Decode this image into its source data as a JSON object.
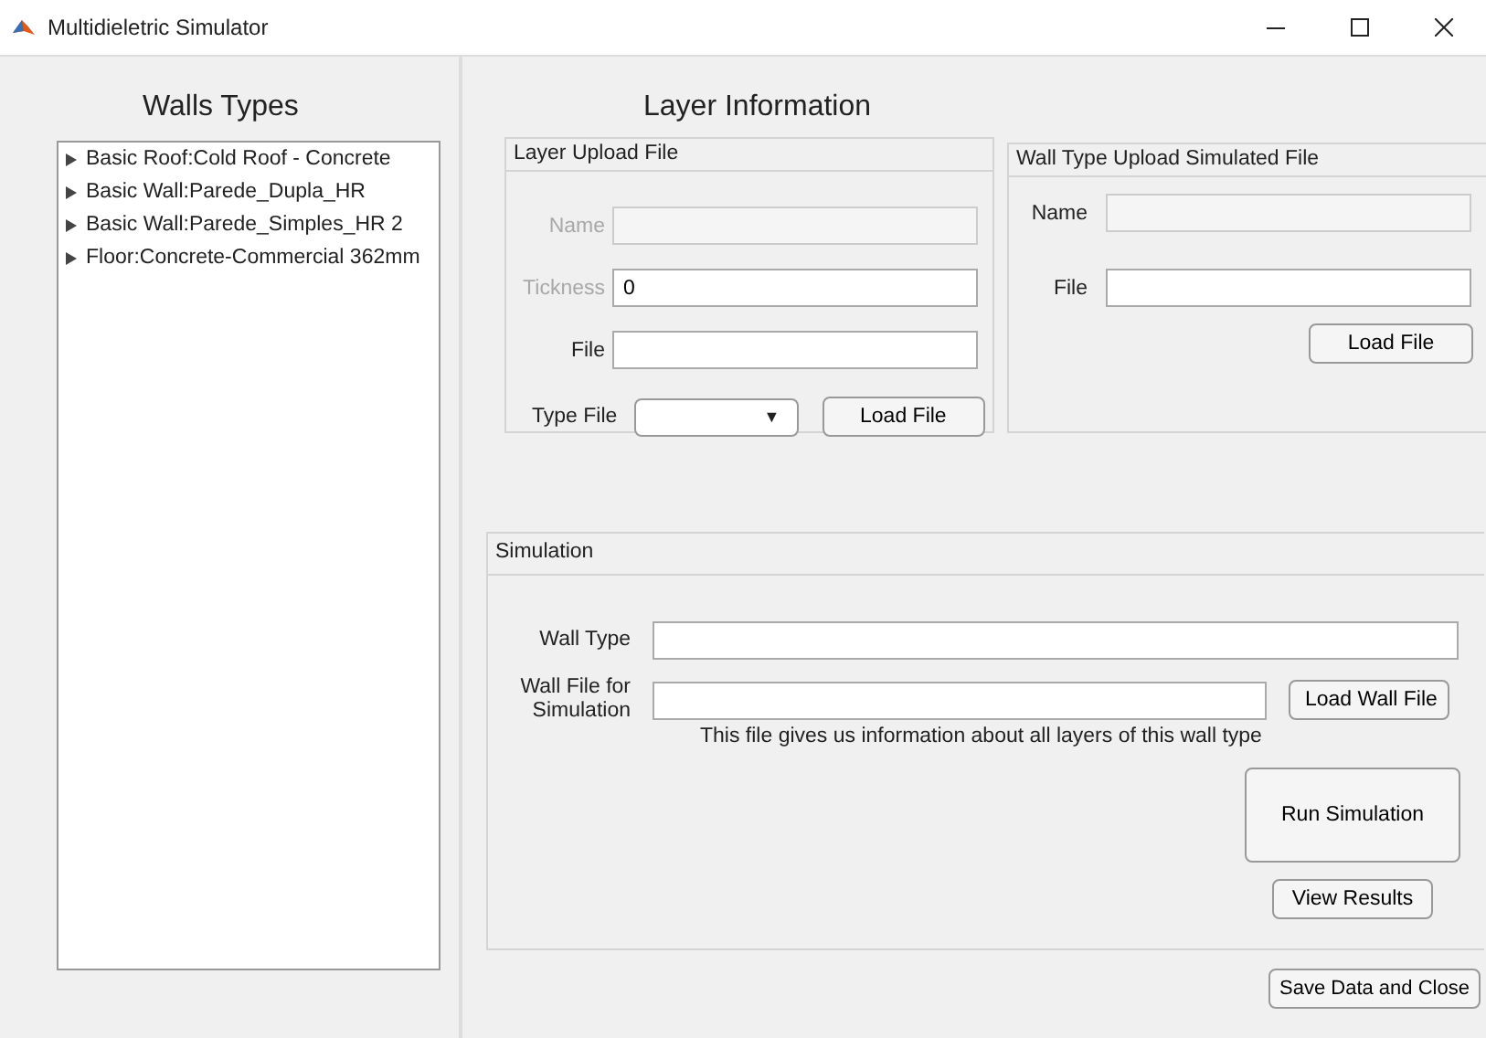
{
  "window": {
    "title": "Multidieletric Simulator"
  },
  "walls_types": {
    "title": "Walls Types",
    "items": [
      {
        "label": "Basic Roof:Cold Roof - Concrete",
        "expanded": false
      },
      {
        "label": "Basic Wall:Parede_Dupla_HR",
        "expanded": false
      },
      {
        "label": "Basic Wall:Parede_Simples_HR 2",
        "expanded": false
      },
      {
        "label": "Floor:Concrete-Commercial 362mm",
        "expanded": false
      }
    ]
  },
  "layer_information": {
    "title": "Layer Information",
    "layer_upload": {
      "title": "Layer Upload File",
      "fields": [
        {
          "label": "Name",
          "disabled": true,
          "label_disabled": true
        },
        {
          "label": "Tickness",
          "value": "0",
          "disabled": false,
          "label_disabled": true
        },
        {
          "label": "File",
          "disabled": false,
          "label_disabled": false
        }
      ],
      "type_file": {
        "label": "Type File",
        "arrow": "▼"
      },
      "button": "Load File"
    },
    "wall_type_upload": {
      "title": "Wall Type Upload Simulated File",
      "fields": [
        {
          "label": "Name"
        },
        {
          "label": "File"
        }
      ],
      "button": "Load File"
    }
  },
  "simulation": {
    "title": "Simulation",
    "wall_type": {
      "label": "Wall Type"
    },
    "wall_file": {
      "label": "Wall File for Simulation",
      "button": "Load Wall File",
      "hint": "This file gives us information about all layers of this wall type"
    },
    "run_button": "Run Simulation",
    "results_button": "View Results"
  },
  "save_button": "Save Data and Close"
}
